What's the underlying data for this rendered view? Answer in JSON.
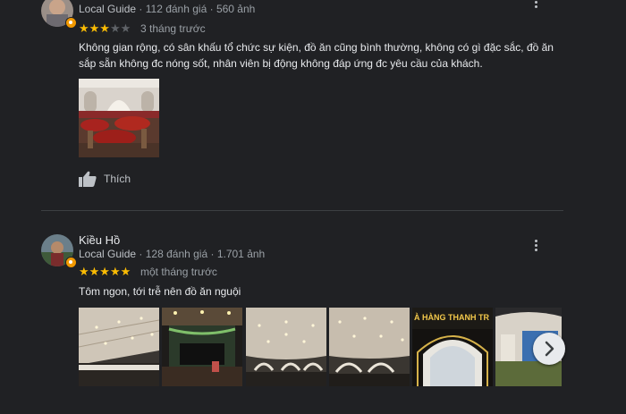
{
  "review1": {
    "guide_label": "Local Guide",
    "reviews_count": "112 đánh giá",
    "photos_count": "560 ảnh",
    "rating": 3,
    "time": "3 tháng trước",
    "text": "Không gian rộng, có sân khấu tổ chức sự kiện, đồ ăn cũng bình thường, không có gì đặc sắc, đồ ăn sắp sẵn không đc nóng sốt, nhân viên bị động không đáp ứng đc yêu cầu của khách.",
    "like_label": "Thích"
  },
  "review2": {
    "author": "Kiều Hồ",
    "guide_label": "Local Guide",
    "reviews_count": "128 đánh giá",
    "photos_count": "1.701 ảnh",
    "rating": 5,
    "time": "một tháng trước",
    "text": "Tôm ngon, tới trễ nên đồ ăn nguội",
    "photo_sign_text": "À HÀNG THANH TR"
  },
  "separator": "·",
  "colors": {
    "background": "#202124",
    "star": "#fbbc04",
    "badge": "#f29900"
  }
}
